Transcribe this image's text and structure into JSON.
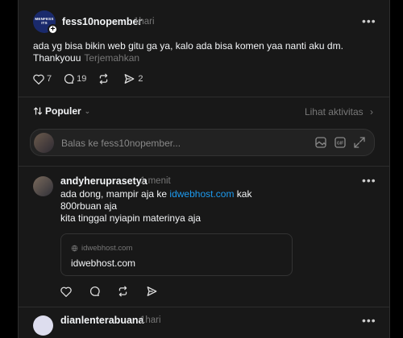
{
  "post": {
    "username": "fess10nopember",
    "time": "1hari",
    "logo_text": "MENFESS\nITS",
    "line1": "ada yg bisa bikin web gitu ga ya, kalo ada bisa komen yaa nanti aku dm.",
    "line2": "Thankyouu",
    "translate": "Terjemahkan",
    "likes": "7",
    "comments": "19",
    "shares": "2"
  },
  "sort": {
    "label": "Populer",
    "activity": "Lihat aktivitas"
  },
  "reply": {
    "placeholder": "Balas ke fess10nopember..."
  },
  "comment": {
    "username": "andyheruprasetya",
    "time": "1 menit",
    "line1_pre": "ada dong, mampir aja ke ",
    "line1_link": "idwebhost.com",
    "line1_post": " kak",
    "line2": "800rbuan aja",
    "line3": "kita tinggal nyiapin materinya aja",
    "card_domain_small": "idwebhost.com",
    "card_domain": "idwebhost.com"
  },
  "next_comment": {
    "username": "dianlenterabuana",
    "time": "1hari"
  },
  "colors": {
    "background": "#000000",
    "panel": "#181818",
    "link": "#1d9bf0",
    "muted": "#777777"
  }
}
